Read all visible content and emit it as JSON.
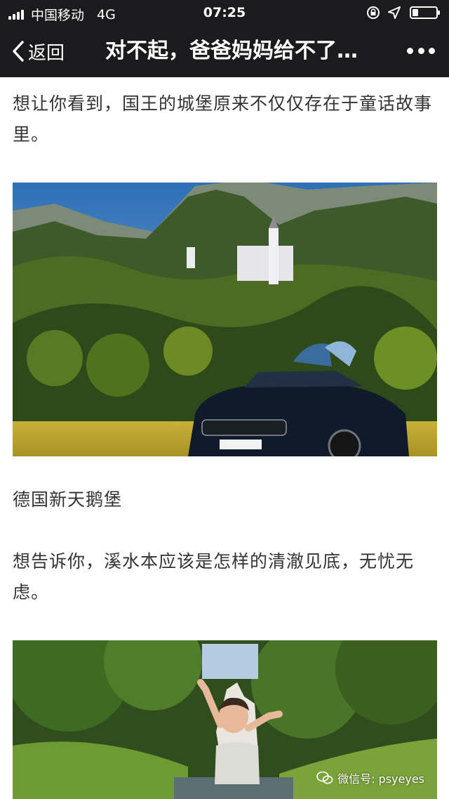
{
  "status_bar": {
    "carrier": "中国移动",
    "network": "4G",
    "time": "07:25",
    "battery_level": 0.25
  },
  "nav": {
    "back_label": "返回",
    "title": "对不起，爸爸妈妈给不了…",
    "more_icon": "more-icon"
  },
  "article": {
    "paragraph_1": "想让你看到，国王的城堡原来不仅仅存在于童话故事里。",
    "caption_1": "德国新天鹅堡",
    "paragraph_2": "想告诉你，溪水本应该是怎样的清澈见底，无忧无虑。"
  },
  "watermark": {
    "text": "微信号: psyeyes"
  }
}
